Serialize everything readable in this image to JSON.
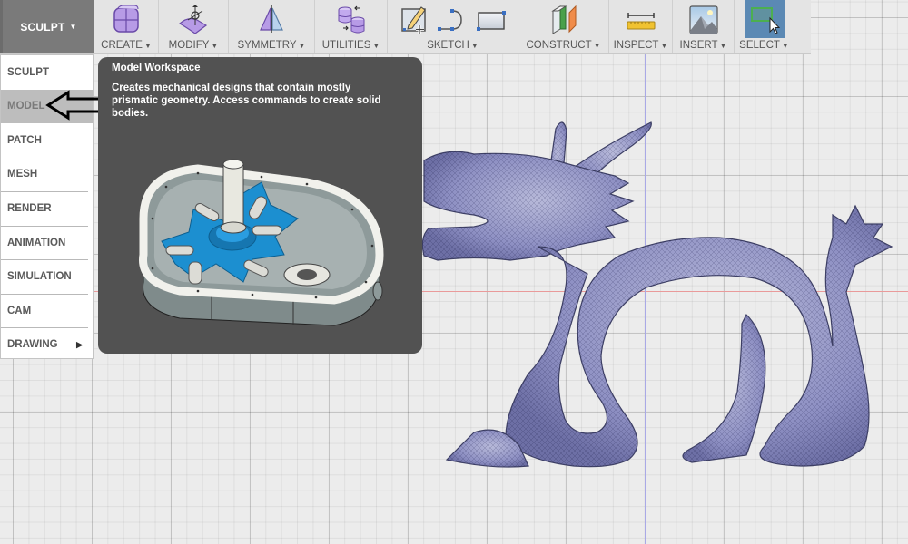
{
  "toolbar": {
    "workspace": {
      "label": "SCULPT",
      "icon": "caret-down-icon"
    },
    "groups": [
      {
        "id": "create",
        "label": "CREATE",
        "icon": "box-form-icon"
      },
      {
        "id": "modify",
        "label": "MODIFY",
        "icon": "edit-form-icon"
      },
      {
        "id": "symmetry",
        "label": "SYMMETRY",
        "icon": "mirror-icon"
      },
      {
        "id": "utilities",
        "label": "UTILITIES",
        "icon": "convert-bodies-icon"
      },
      {
        "id": "sketch",
        "label": "SKETCH",
        "icons": [
          "create-sketch-icon",
          "arc-line-icon",
          "rectangle-icon"
        ]
      },
      {
        "id": "construct",
        "label": "CONSTRUCT",
        "icon": "plane-icon"
      },
      {
        "id": "inspect",
        "label": "INSPECT",
        "icon": "measure-icon"
      },
      {
        "id": "insert",
        "label": "INSERT",
        "icon": "image-icon"
      },
      {
        "id": "select",
        "label": "SELECT",
        "icon": "window-select-icon",
        "active": true
      }
    ]
  },
  "workspace_menu": {
    "items": [
      {
        "label": "SCULPT"
      },
      {
        "label": "MODEL",
        "highlighted": true
      },
      {
        "label": "PATCH"
      },
      {
        "label": "MESH"
      },
      {
        "label": "RENDER"
      },
      {
        "label": "ANIMATION"
      },
      {
        "label": "SIMULATION"
      },
      {
        "label": "CAM"
      },
      {
        "label": "DRAWING",
        "has_submenu": true
      }
    ]
  },
  "tooltip": {
    "title": "Model Workspace",
    "body": "Creates mechanical designs that contain mostly prismatic geometry. Access commands to create solid bodies.",
    "image": "gearbox-model-preview"
  },
  "viewport": {
    "model": "dragon-mesh",
    "colors": {
      "mesh": "#8f91c4",
      "x_axis": "#e99a9a",
      "z_axis": "#a9a9e6",
      "select_active": "#5b89b4"
    }
  }
}
